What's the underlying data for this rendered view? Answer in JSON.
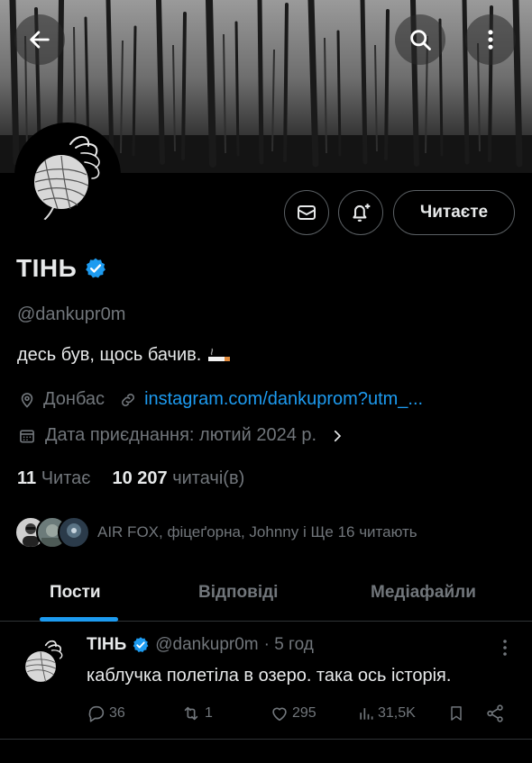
{
  "header": {
    "back_icon": "arrow-left-icon",
    "search_icon": "search-icon",
    "more_icon": "more-vertical-icon"
  },
  "profile": {
    "name": "ТІНЬ",
    "verified_icon": "verified-badge-icon",
    "verified_color": "#1d9bf0",
    "handle": "@dankupr0m",
    "bio": "десь був, щось бачив.",
    "location": "Донбас",
    "link": "instagram.com/dankuprom?utm_...",
    "joined": "Дата приєднання: лютий 2024 р.",
    "following_count": "11",
    "following_label": "Читає",
    "followers_count": "10 207",
    "followers_label": "читачі(в)",
    "followed_by": "AIR FOX, фіцеґорна, Johnny і Ще 16 читають"
  },
  "actions": {
    "message_icon": "mail-icon",
    "notify_icon": "bell-plus-icon",
    "follow_label": "Читаєте"
  },
  "tabs": [
    {
      "label": "Пости",
      "active": true
    },
    {
      "label": "Відповіді",
      "active": false
    },
    {
      "label": "Медіафайли",
      "active": false
    }
  ],
  "post": {
    "author": "ТІНЬ",
    "handle": "@dankupr0m",
    "time": "· 5 год",
    "text": "каблучка полетіла в озеро. така ось історія.",
    "replies": "36",
    "reposts": "1",
    "likes": "295",
    "views": "31,5K"
  },
  "accent_color": "#1d9bf0"
}
